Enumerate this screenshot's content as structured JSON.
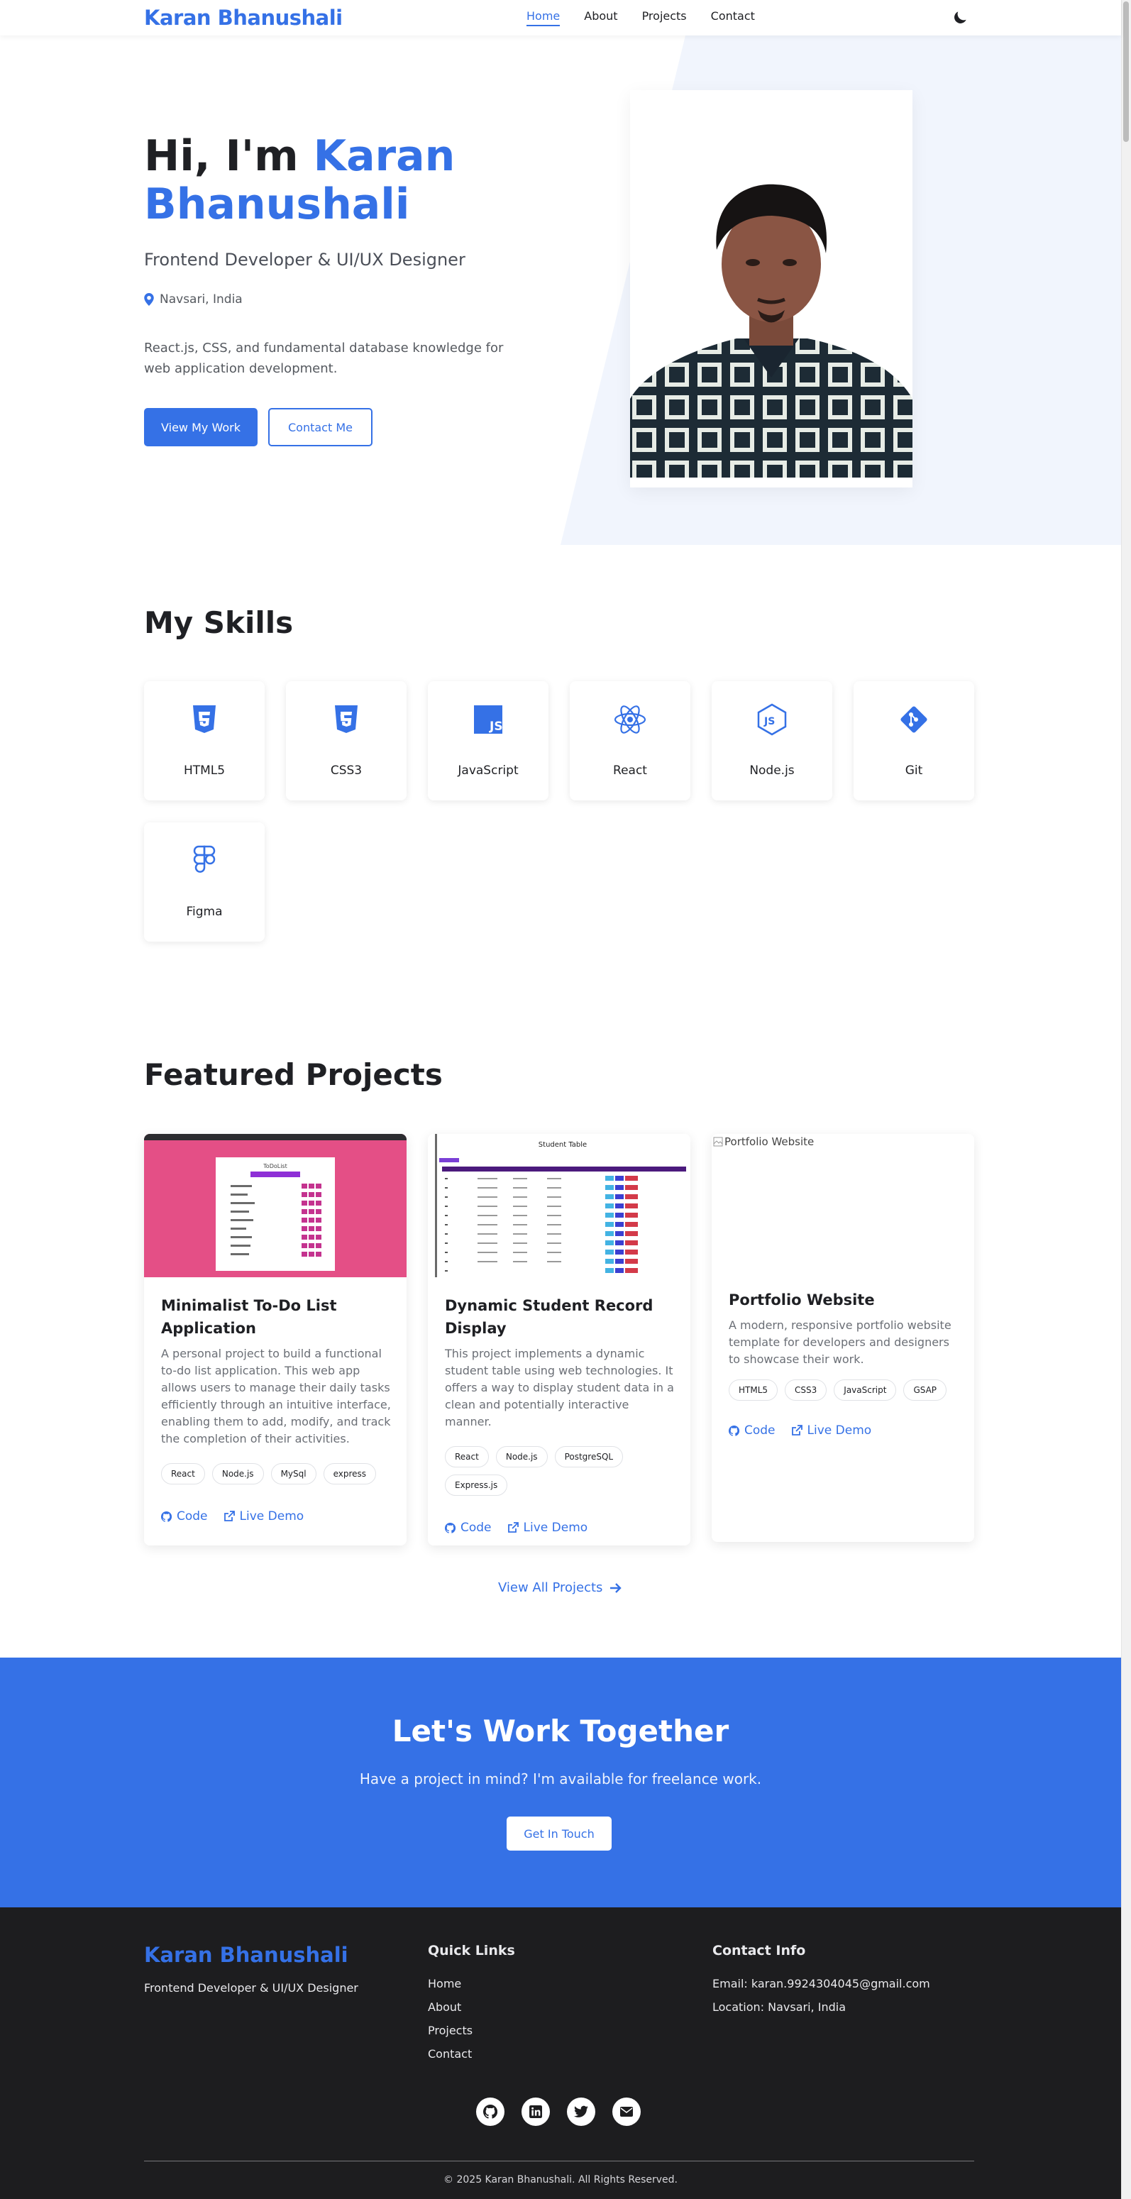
{
  "nav": {
    "brand": "Karan Bhanushali",
    "links": [
      "Home",
      "About",
      "Projects",
      "Contact"
    ]
  },
  "hero": {
    "greeting": "Hi, I'm ",
    "name_line1": "Karan",
    "name_line2": "Bhanushali",
    "subtitle": "Frontend Developer & UI/UX Designer",
    "location": "Navsari, India",
    "description": "React.js, CSS, and fundamental database knowledge for web application development.",
    "btn_primary": "View My Work",
    "btn_secondary": "Contact Me"
  },
  "skills": {
    "title": "My Skills",
    "items": [
      "HTML5",
      "CSS3",
      "JavaScript",
      "React",
      "Node.js",
      "Git",
      "Figma"
    ]
  },
  "projects": {
    "title": "Featured Projects",
    "items": [
      {
        "title": "Minimalist To-Do List Application",
        "description": "A personal project to build a functional to-do list application. This web app allows users to manage their daily tasks efficiently through an intuitive interface, enabling them to add, modify, and track the completion of their activities.",
        "tags": [
          "React",
          "Node.js",
          "MySql",
          "express"
        ],
        "code": "Code",
        "demo": "Live Demo"
      },
      {
        "title": "Dynamic Student Record Display",
        "description": "This project implements a dynamic student table using web technologies. It offers a way to display student data in a clean and potentially interactive manner.",
        "tags": [
          "React",
          "Node.js",
          "PostgreSQL",
          "Express.js"
        ],
        "thumb_title": "Student Table",
        "code": "Code",
        "demo": "Live Demo"
      },
      {
        "title": "Portfolio Website",
        "description": "A modern, responsive portfolio website template for developers and designers to showcase their work.",
        "tags": [
          "HTML5",
          "CSS3",
          "JavaScript",
          "GSAP"
        ],
        "alt": "Portfolio Website",
        "code": "Code",
        "demo": "Live Demo"
      }
    ],
    "view_all": "View All Projects"
  },
  "cta": {
    "title": "Let's Work Together",
    "subtitle": "Have a project in mind? I'm available for freelance work.",
    "button": "Get In Touch"
  },
  "footer": {
    "brand": "Karan Bhanushali",
    "tagline": "Frontend Developer & UI/UX Designer",
    "quick_links_title": "Quick Links",
    "quick_links": [
      "Home",
      "About",
      "Projects",
      "Contact"
    ],
    "contact_title": "Contact Info",
    "email": "Email: karan.9924304045@gmail.com",
    "location": "Location: Navsari, India",
    "copyright": "© 2025 Karan Bhanushali. All Rights Reserved."
  },
  "colors": {
    "accent": "#3571e6",
    "dark": "#1f2024",
    "footer_bg": "#1d1d1f"
  }
}
